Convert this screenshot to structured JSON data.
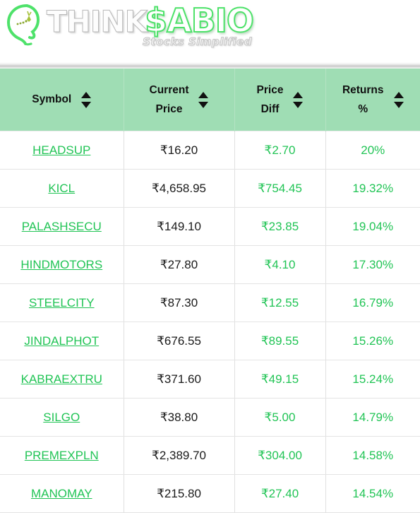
{
  "brand": {
    "name_part1": "THINK",
    "name_part2": "$ABIO",
    "tagline": "Stocks Simplified",
    "colors": {
      "accent_green": "#21c455",
      "logo_green": "#4ee26a",
      "header_green": "#9fddb4",
      "text_dark": "#1a1a1a"
    }
  },
  "table": {
    "columns": [
      {
        "label": "Symbol",
        "key": "symbol",
        "sortable": true
      },
      {
        "label": "Current\nPrice",
        "key": "price",
        "sortable": true
      },
      {
        "label": "Price\nDiff",
        "key": "diff",
        "sortable": true
      },
      {
        "label": "Returns\n%",
        "key": "returns",
        "sortable": true
      }
    ],
    "rows": [
      {
        "symbol": "HEADSUP",
        "price": "₹16.20",
        "diff": "₹2.70",
        "returns": "20%"
      },
      {
        "symbol": "KICL",
        "price": "₹4,658.95",
        "diff": "₹754.45",
        "returns": "19.32%"
      },
      {
        "symbol": "PALASHSECU",
        "price": "₹149.10",
        "diff": "₹23.85",
        "returns": "19.04%"
      },
      {
        "symbol": "HINDMOTORS",
        "price": "₹27.80",
        "diff": "₹4.10",
        "returns": "17.30%"
      },
      {
        "symbol": "STEELCITY",
        "price": "₹87.30",
        "diff": "₹12.55",
        "returns": "16.79%"
      },
      {
        "symbol": "JINDALPHOT",
        "price": "₹676.55",
        "diff": "₹89.55",
        "returns": "15.26%"
      },
      {
        "symbol": "KABRAEXTRU",
        "price": "₹371.60",
        "diff": "₹49.15",
        "returns": "15.24%"
      },
      {
        "symbol": "SILGO",
        "price": "₹38.80",
        "diff": "₹5.00",
        "returns": "14.79%"
      },
      {
        "symbol": "PREMEXPLN",
        "price": "₹2,389.70",
        "diff": "₹304.00",
        "returns": "14.58%"
      },
      {
        "symbol": "MANOMAY",
        "price": "₹215.80",
        "diff": "₹27.40",
        "returns": "14.54%"
      }
    ]
  }
}
